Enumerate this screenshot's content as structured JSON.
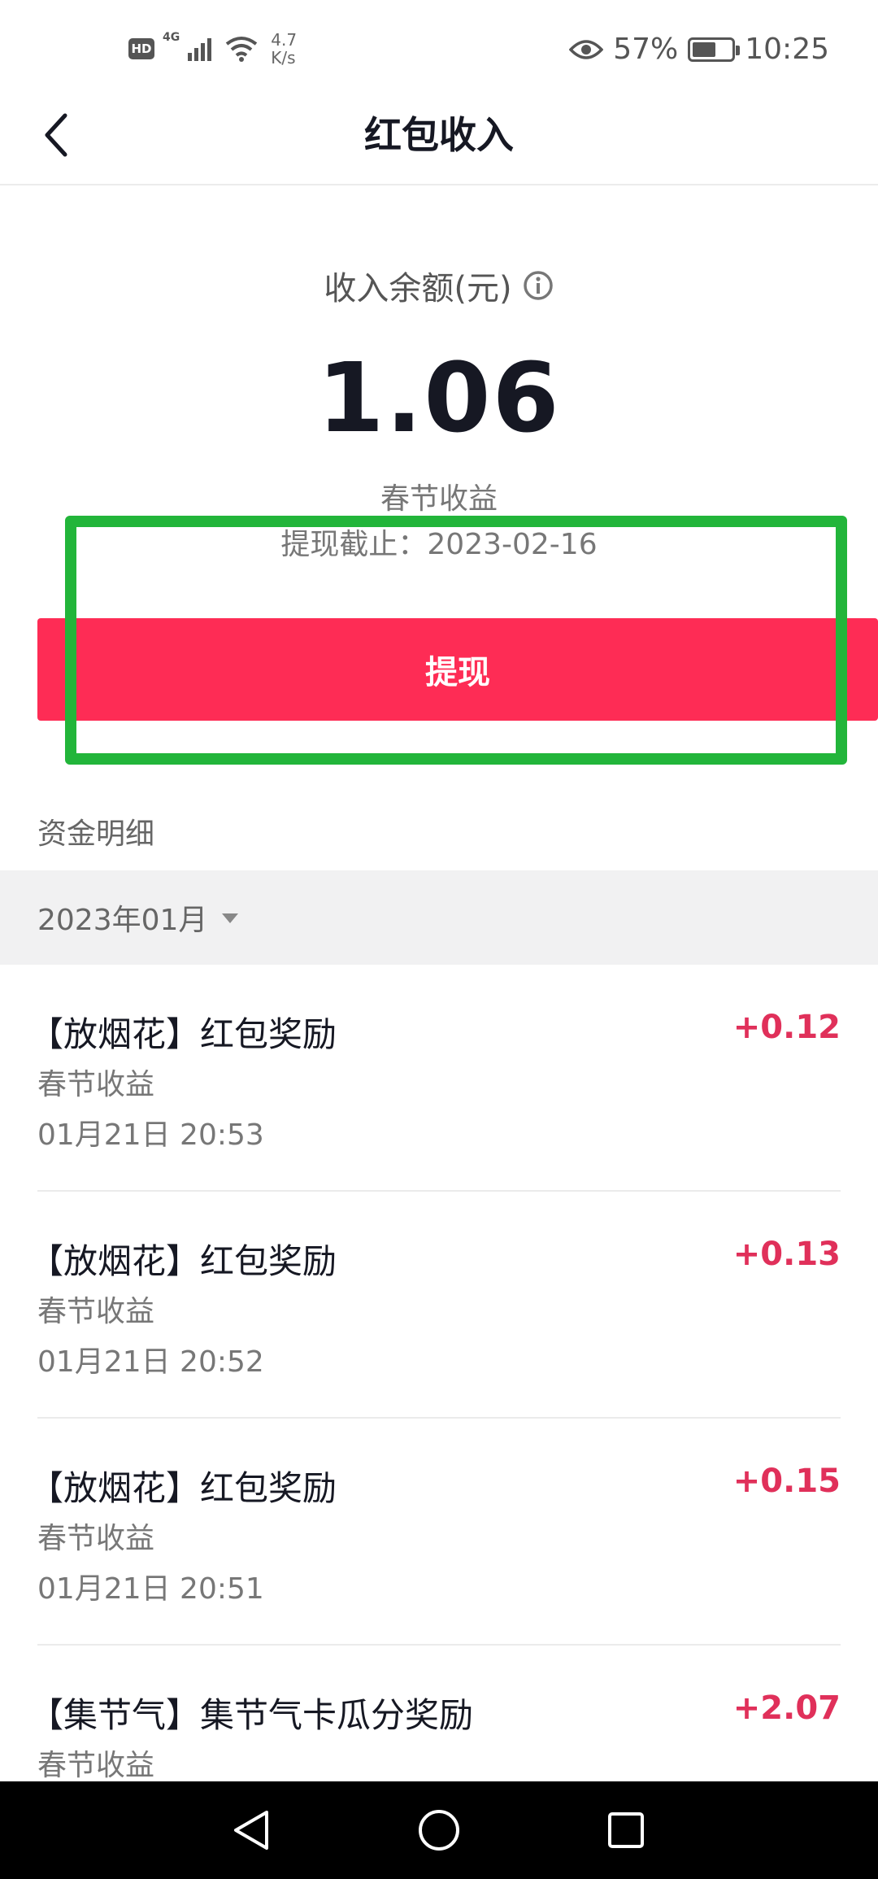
{
  "status_bar": {
    "hd": "HD",
    "network": "4G",
    "speed_value": "4.7",
    "speed_unit": "K/s",
    "battery_percent": "57%",
    "time": "10:25"
  },
  "header": {
    "title": "红包收入",
    "back_icon": "chevron-left-icon"
  },
  "balance": {
    "label": "收入余额(元)",
    "value": "1.06",
    "source": "春节收益",
    "deadline": "提现截止：2023-02-16"
  },
  "withdraw_button": {
    "label": "提现"
  },
  "details": {
    "section_title": "资金明细",
    "month_filter": "2023年01月"
  },
  "transactions": [
    {
      "title": "【放烟花】红包奖励",
      "amount": "+0.12",
      "source": "春节收益",
      "time": "01月21日 20:53"
    },
    {
      "title": "【放烟花】红包奖励",
      "amount": "+0.13",
      "source": "春节收益",
      "time": "01月21日 20:52"
    },
    {
      "title": "【放烟花】红包奖励",
      "amount": "+0.15",
      "source": "春节收益",
      "time": "01月21日 20:51"
    },
    {
      "title": "【集节气】集节气卡瓜分奖励",
      "amount": "+2.07",
      "source": "春节收益",
      "time": ""
    }
  ],
  "colors": {
    "accent": "#fe2c55",
    "amount": "#e0305a",
    "highlight": "#22b53a"
  }
}
